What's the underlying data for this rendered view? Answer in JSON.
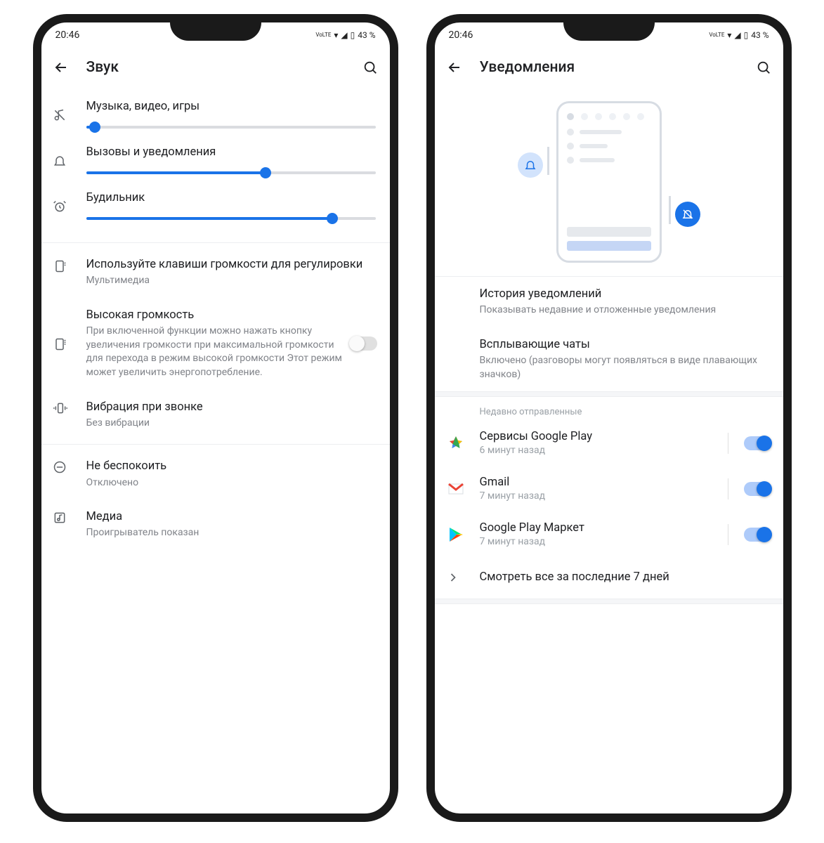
{
  "status": {
    "time": "20:46",
    "volte": "VoLTE",
    "battery": "43 %"
  },
  "left": {
    "title": "Звук",
    "sliders": [
      {
        "label": "Музыка, видео, игры",
        "value": 3
      },
      {
        "label": "Вызовы и уведомления",
        "value": 62
      },
      {
        "label": "Будильник",
        "value": 85
      }
    ],
    "volumeKeys": {
      "title": "Используйте клавиши громкости для регулировки",
      "sub": "Мультимедиа"
    },
    "highVolume": {
      "title": "Высокая громкость",
      "sub": "При включенной функции можно нажать кнопку увеличения громкости при максимальной громкости для перехода в режим высокой громкости Этот режим может увеличить энергопотребление.",
      "enabled": false
    },
    "vibration": {
      "title": "Вибрация при звонке",
      "sub": "Без вибрации"
    },
    "dnd": {
      "title": "Не беспокоить",
      "sub": "Отключено"
    },
    "media": {
      "title": "Медиа",
      "sub": "Проигрыватель показан"
    }
  },
  "right": {
    "title": "Уведомления",
    "history": {
      "title": "История уведомлений",
      "sub": "Показывать недавние и отложенные уведомления"
    },
    "bubbles": {
      "title": "Всплывающие чаты",
      "sub": "Включено (разговоры могут появляться в виде плавающих значков)"
    },
    "recentLabel": "Недавно отправленные",
    "apps": [
      {
        "name": "Сервисы Google Play",
        "time": "6 минут назад",
        "enabled": true
      },
      {
        "name": "Gmail",
        "time": "7 минут назад",
        "enabled": true
      },
      {
        "name": "Google Play Маркет",
        "time": "7 минут назад",
        "enabled": true
      }
    ],
    "seeAll": "Смотреть все за последние 7 дней"
  }
}
